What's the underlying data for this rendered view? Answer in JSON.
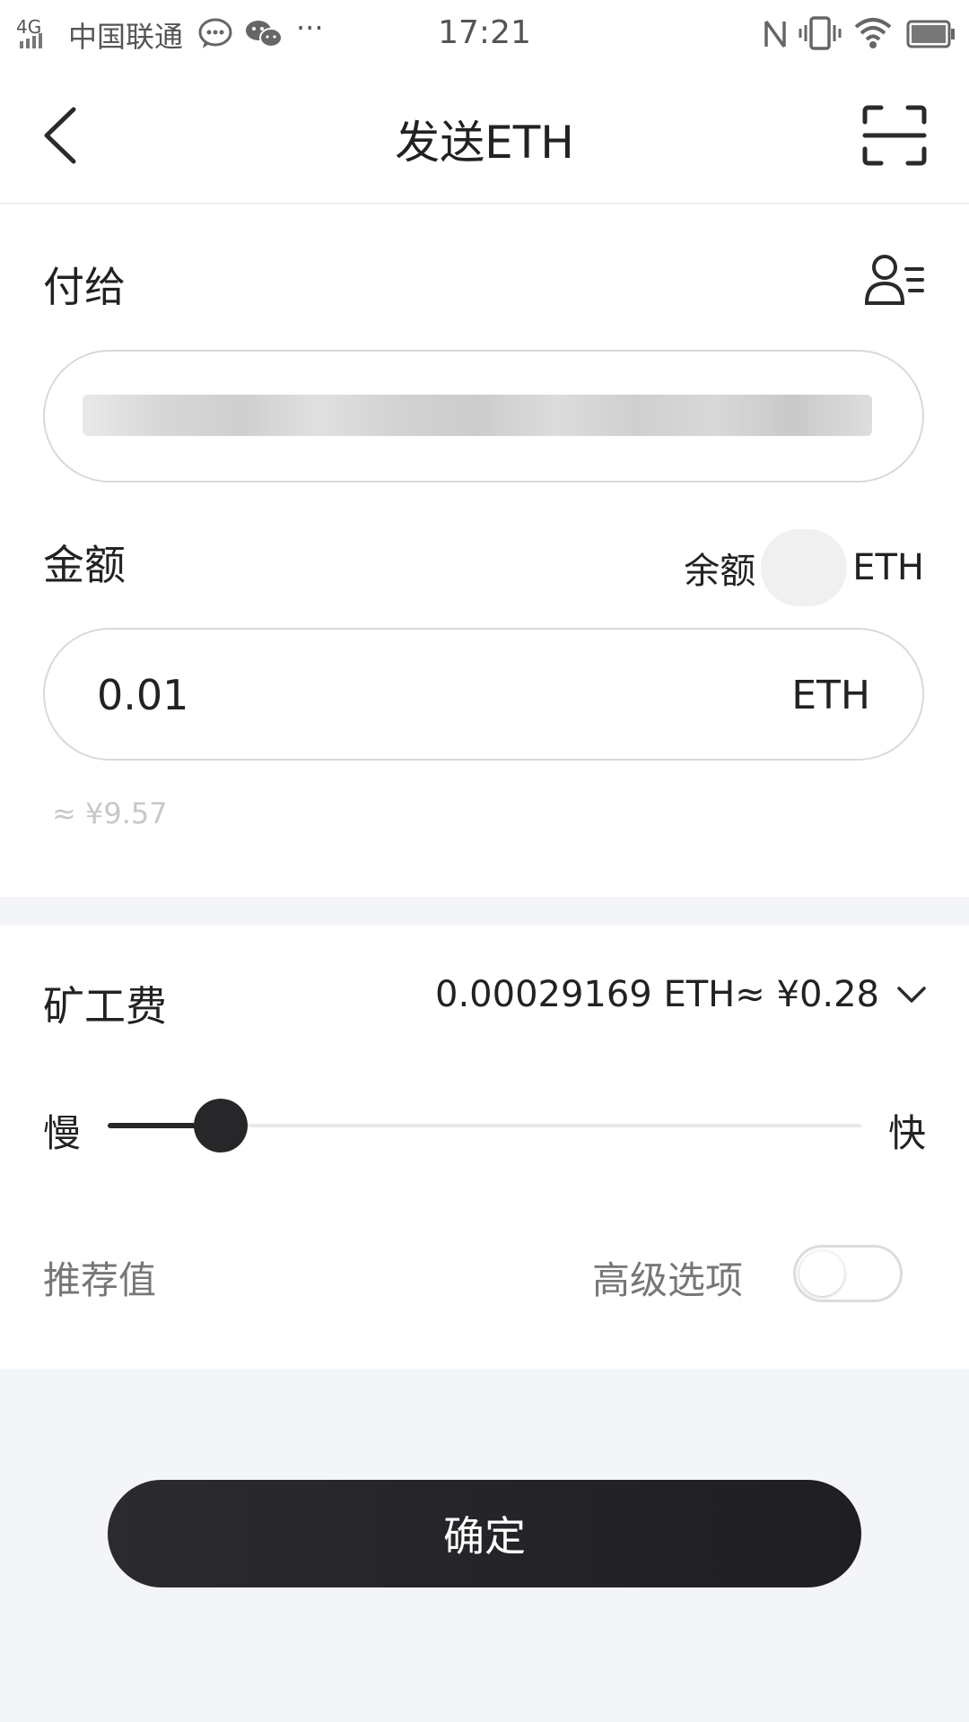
{
  "status_bar": {
    "network": "4G",
    "carrier": "中国联通",
    "time": "17:21",
    "more": "···"
  },
  "header": {
    "title": "发送ETH"
  },
  "pay_to": {
    "label": "付给"
  },
  "amount": {
    "label": "金额",
    "balance_label": "余额",
    "balance_unit": "ETH",
    "value": "0.01",
    "unit": "ETH",
    "approx": "≈ ¥9.57"
  },
  "fee": {
    "label": "矿工费",
    "value": "0.00029169 ETH≈ ¥0.28",
    "slow": "慢",
    "fast": "快",
    "slider_level": 0.15,
    "recommended": "推荐值",
    "advanced": "高级选项",
    "advanced_enabled": false
  },
  "confirm_button": {
    "label": "确定"
  },
  "colors": {
    "accent": "#27272a",
    "page_bg": "#f3f5f8",
    "muted": "#777777"
  },
  "icons": {
    "back": "chevron-left-icon",
    "scan": "scan-icon",
    "contacts": "contact-list-icon",
    "dropdown": "chevron-down-icon"
  }
}
